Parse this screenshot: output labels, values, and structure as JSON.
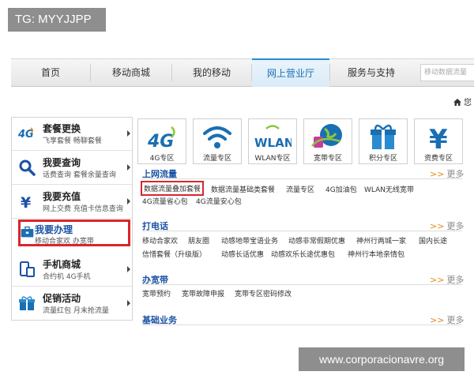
{
  "tag": "TG: MYYJJPP",
  "nav": {
    "items": [
      "首页",
      "移动商城",
      "我的移动",
      "网上营业厅",
      "服务与支持"
    ],
    "search_placeholder": "移动数据流量"
  },
  "breadcrumb": {
    "home": "您"
  },
  "sidebar": [
    {
      "title": "套餐更换",
      "sub": "飞享套餐  畅聊套餐"
    },
    {
      "title": "我要查询",
      "sub": "话费查询  套餐余量查询"
    },
    {
      "title": "我要充值",
      "sub": "网上交费  充值卡信息查询"
    },
    {
      "title": "我要办理",
      "sub": "移动合家欢  办宽带"
    },
    {
      "title": "手机商城",
      "sub": "合约机  4G手机"
    },
    {
      "title": "促销活动",
      "sub": "流量红包  月末抢流量"
    }
  ],
  "tiles": [
    {
      "icon_text": "4G",
      "label": "4G专区"
    },
    {
      "icon_text": "",
      "label": "流量专区"
    },
    {
      "icon_text": "WLAN",
      "label": "WLAN专区"
    },
    {
      "icon_text": "",
      "label": "宽带专区"
    },
    {
      "icon_text": "",
      "label": "积分专区"
    },
    {
      "icon_text": "¥",
      "label": "资费专区"
    }
  ],
  "sections": {
    "more_label": "更多",
    "more_arrows": ">>",
    "s1": {
      "title": "上网流量",
      "row1": [
        "数据流量叠加套餐",
        "数据流量基础类套餐",
        "流量专区",
        "4G加油包",
        "WLAN无线宽带"
      ],
      "row2": [
        "4G流量省心包",
        "4G流量安心包"
      ]
    },
    "s2": {
      "title": "打电话",
      "row1": [
        "移动合家欢",
        "朋友圈",
        "动感地带宝语业务",
        "动感非常假期优惠",
        "神州行两城一家",
        "国内长途"
      ],
      "row2": [
        "信惜套餐（升级版）",
        "动感长话优惠",
        "动感欢乐长途优惠包",
        "神州行本地亲情包"
      ]
    },
    "s3": {
      "title": "办宽带",
      "row1": [
        "宽带预约",
        "宽带故障申报",
        "宽带专区密码修改"
      ]
    },
    "s4": {
      "title": "基础业务"
    }
  },
  "watermark": "www.corporacionavre.org",
  "colors": {
    "accent_blue": "#1a52a3",
    "highlight_red": "#d9262c",
    "more_orange": "#e08a1e"
  }
}
